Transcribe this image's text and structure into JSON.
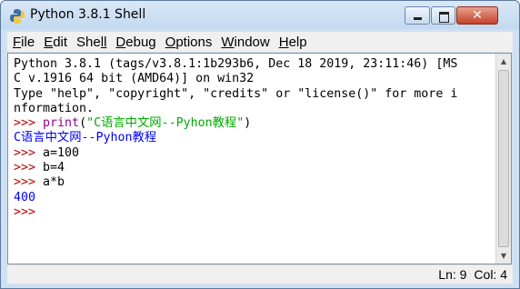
{
  "window": {
    "title": "Python 3.8.1 Shell",
    "icon": "python-logo-icon",
    "controls": {
      "minimize_icon": "minimize-icon",
      "maximize_icon": "maximize-icon",
      "close_icon": "close-icon",
      "close_glyph": "✕"
    }
  },
  "menu": {
    "items": [
      {
        "accel": "F",
        "rest": "ile"
      },
      {
        "accel": "E",
        "rest": "dit"
      },
      {
        "accel": "S",
        "pre": "She",
        "rest": "ll",
        "accel_index": 1
      },
      {
        "accel": "D",
        "rest": "ebug"
      },
      {
        "accel": "O",
        "rest": "ptions"
      },
      {
        "accel": "W",
        "rest": "indow"
      },
      {
        "accel": "H",
        "rest": "elp"
      }
    ]
  },
  "shell": {
    "lines": [
      [
        {
          "t": "Python 3.8.1 (tags/v3.8.1:1b293b6, Dec 18 2019, 23:11:46) [MS",
          "c": "normal"
        }
      ],
      [
        {
          "t": "C v.1916 64 bit (AMD64)] on win32",
          "c": "normal"
        }
      ],
      [
        {
          "t": "Type \"help\", \"copyright\", \"credits\" or \"license()\" for more i",
          "c": "normal"
        }
      ],
      [
        {
          "t": "nformation.",
          "c": "normal"
        }
      ],
      [
        {
          "t": ">>> ",
          "c": "prompt"
        },
        {
          "t": "print",
          "c": "builtin"
        },
        {
          "t": "(",
          "c": "normal"
        },
        {
          "t": "\"C语言中文网--Pyhon教程\"",
          "c": "string"
        },
        {
          "t": ")",
          "c": "normal"
        }
      ],
      [
        {
          "t": "C语言中文网--Pyhon教程",
          "c": "stdout"
        }
      ],
      [
        {
          "t": ">>> ",
          "c": "prompt"
        },
        {
          "t": "a=100",
          "c": "normal"
        }
      ],
      [
        {
          "t": ">>> ",
          "c": "prompt"
        },
        {
          "t": "b=4",
          "c": "normal"
        }
      ],
      [
        {
          "t": ">>> ",
          "c": "prompt"
        },
        {
          "t": "a*b",
          "c": "normal"
        }
      ],
      [
        {
          "t": "400",
          "c": "stdout"
        }
      ],
      [
        {
          "t": ">>> ",
          "c": "prompt"
        }
      ]
    ],
    "colors": {
      "prompt": "#c00000",
      "builtin": "#900090",
      "string": "#00aa00",
      "stdout": "#0000ff"
    }
  },
  "scrollbar": {
    "up_icon": "scroll-up-arrow-icon",
    "down_icon": "scroll-down-arrow-icon",
    "up_glyph": "▲",
    "down_glyph": "▼"
  },
  "status": {
    "line": "Ln: 9",
    "col": "Col: 4"
  }
}
